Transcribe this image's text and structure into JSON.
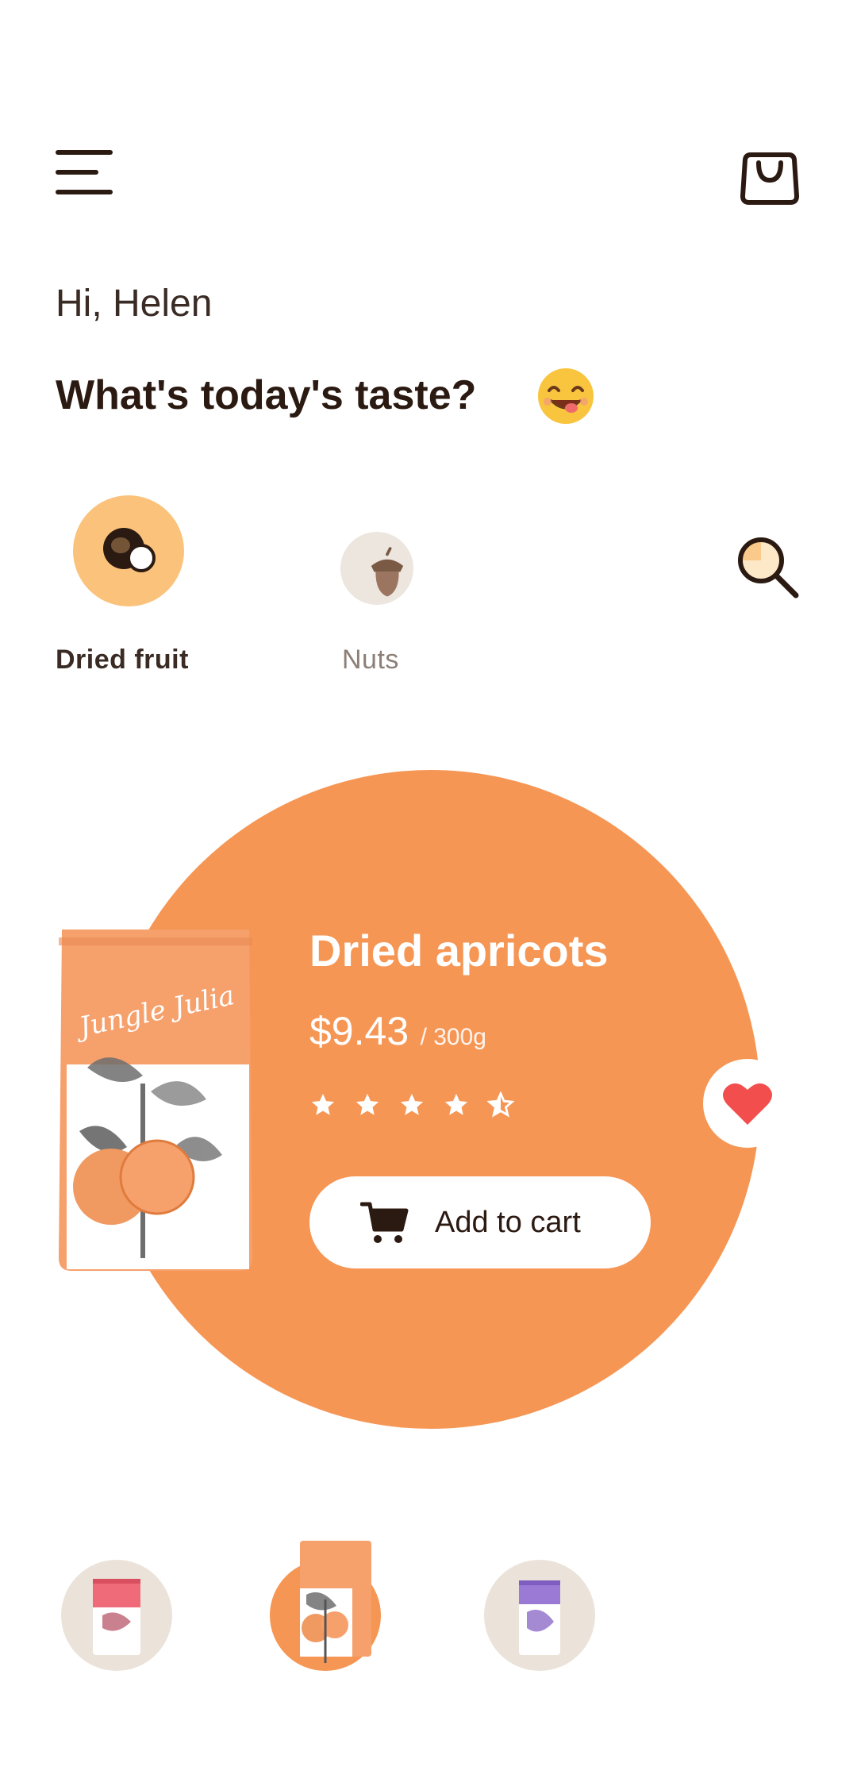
{
  "header": {
    "menu_icon": "hamburger-menu-icon",
    "bag_icon": "shopping-bag-icon"
  },
  "greeting": {
    "hello": "Hi, Helen",
    "question": "What's today's taste?",
    "emoji_icon": "smiling-face-emoji"
  },
  "categories": [
    {
      "label": "Dried fruit",
      "icon": "dried-fruit-icon",
      "selected": true
    },
    {
      "label": "Nuts",
      "icon": "acorn-icon",
      "selected": false
    }
  ],
  "search": {
    "icon": "search-icon"
  },
  "featured": {
    "name": "Dried apricots",
    "price": "$9.43",
    "unit": "/ 300g",
    "rating": 4.5,
    "rating_max": 5,
    "cart_label": "Add to cart",
    "favorite": true,
    "brand_text": "Jungle Julia"
  },
  "thumbnails": [
    {
      "name": "pink-pack",
      "selected": false
    },
    {
      "name": "apricot-pack",
      "selected": true
    },
    {
      "name": "purple-pack",
      "selected": false
    }
  ],
  "colors": {
    "accent": "#f69654",
    "category_active": "#fbc27b",
    "text_dark": "#2b1a12",
    "heart": "#f24e4e"
  }
}
